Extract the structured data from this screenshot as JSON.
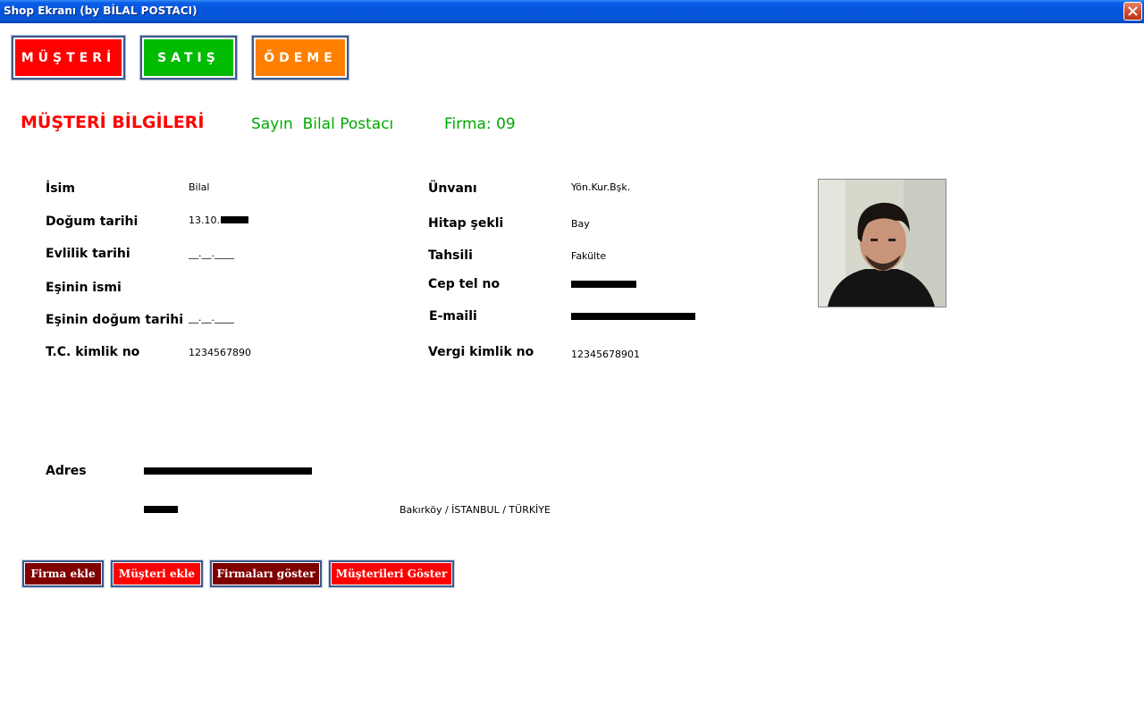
{
  "window": {
    "title": "Shop Ekranı (by BİLAL POSTACI)"
  },
  "nav": {
    "musteri_label": "MÜŞTERİ",
    "satis_label": "SATIŞ",
    "odeme_label": "ÖDEME"
  },
  "header": {
    "section_title": "MÜŞTERİ BİLGİLERİ",
    "greeting": "Sayın  Bilal Postacı",
    "firma": "Firma: 09"
  },
  "left_fields": [
    {
      "label": "İsim",
      "value": "Bilal"
    },
    {
      "label": "Doğum tarihi",
      "value": "13.10."
    },
    {
      "label": "Evlilik tarihi",
      "value": "__.__.____"
    },
    {
      "label": "Eşinin ismi",
      "value": ""
    },
    {
      "label": "Eşinin doğum tarihi",
      "value": "__.__.____"
    },
    {
      "label": "T.C. kimlik no",
      "value": "1234567890"
    }
  ],
  "right_fields": [
    {
      "label": "Ünvanı",
      "value": "Yön.Kur.Bşk."
    },
    {
      "label": "Hitap şekli",
      "value": "Bay"
    },
    {
      "label": "Tahsili",
      "value": "Fakülte"
    },
    {
      "label": "Cep tel no",
      "value": ""
    },
    {
      "label": "E-maili",
      "value": ""
    },
    {
      "label": "Vergi kimlik no",
      "value": "12345678901"
    }
  ],
  "address": {
    "label": "Adres",
    "city_line": "Bakırköy / İSTANBUL / TÜRKİYE"
  },
  "actions": {
    "firma_ekle": "Firma ekle",
    "musteri_ekle": "Müşteri ekle",
    "firmalari_goster": "Firmaları göster",
    "musterileri_goster": "Müşterileri Göster"
  },
  "colors": {
    "red": "#ff0000",
    "green": "#00bb00",
    "orange": "#ff7f00",
    "dark_red": "#800000"
  },
  "icons": {
    "close": "close-icon",
    "photo": "customer-photo"
  }
}
